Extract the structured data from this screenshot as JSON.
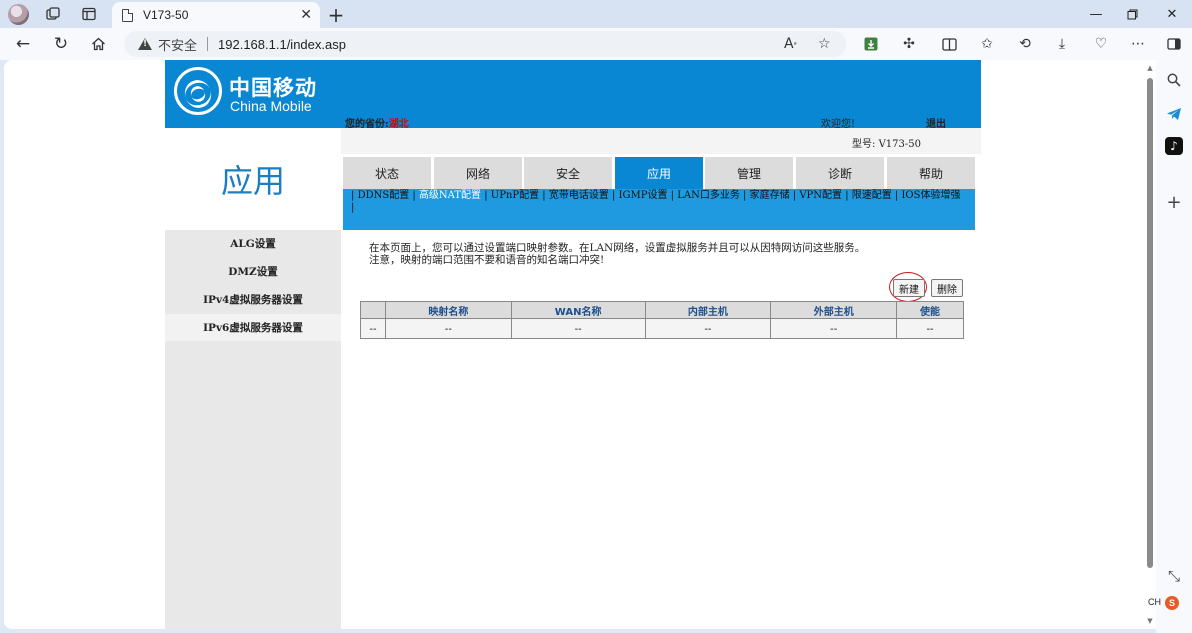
{
  "browser": {
    "tab_title": "V173-50",
    "insecure_label": "不安全",
    "url": "192.168.1.1/index.asp"
  },
  "header": {
    "logo_cn": "中国移动",
    "logo_en": "China Mobile",
    "province_label": "您的省份:",
    "province_value": "湖北",
    "welcome": "欢迎您!",
    "logout": "退出",
    "model": "型号: V173-50"
  },
  "sidebar": {
    "title": "应用",
    "items": [
      {
        "label": "ALG设置",
        "active": false
      },
      {
        "label": "DMZ设置",
        "active": false
      },
      {
        "label": "IPv4虚拟服务器设置",
        "active": false
      },
      {
        "label": "IPv6虚拟服务器设置",
        "active": true
      }
    ]
  },
  "main_tabs": [
    {
      "label": "状态",
      "active": false
    },
    {
      "label": "网络",
      "active": false
    },
    {
      "label": "安全",
      "active": false
    },
    {
      "label": "应用",
      "active": true
    },
    {
      "label": "管理",
      "active": false
    },
    {
      "label": "诊断",
      "active": false
    },
    {
      "label": "帮助",
      "active": false
    }
  ],
  "sub_nav": [
    {
      "label": "DDNS配置",
      "active": false
    },
    {
      "label": "高级NAT配置",
      "active": true
    },
    {
      "label": "UPnP配置",
      "active": false
    },
    {
      "label": "宽带电话设置",
      "active": false
    },
    {
      "label": "IGMP设置",
      "active": false
    },
    {
      "label": "LAN口多业务",
      "active": false
    },
    {
      "label": "家庭存储",
      "active": false
    },
    {
      "label": "VPN配置",
      "active": false
    },
    {
      "label": "限速配置",
      "active": false
    },
    {
      "label": "IOS体验增强",
      "active": false
    }
  ],
  "content": {
    "description_1": "在本页面上，您可以通过设置端口映射参数。在LAN网络，设置虚拟服务并且可以从因特网访问这些服务。",
    "description_2": "注意，映射的端口范围不要和语音的知名端口冲突!",
    "new_button": "新建",
    "delete_button": "删除"
  },
  "table": {
    "headers": [
      "",
      "映射名称",
      "WAN名称",
      "内部主机",
      "外部主机",
      "使能"
    ],
    "rows": [
      [
        "--",
        "--",
        "--",
        "--",
        "--",
        "--"
      ]
    ]
  },
  "ime": {
    "lang": "CH",
    "brand": "S"
  },
  "colors": {
    "banner_blue": "#0a87d3",
    "subnav_blue": "#1f9ae0",
    "active_red": "#e00000",
    "title_blue": "#1a7fc0"
  }
}
